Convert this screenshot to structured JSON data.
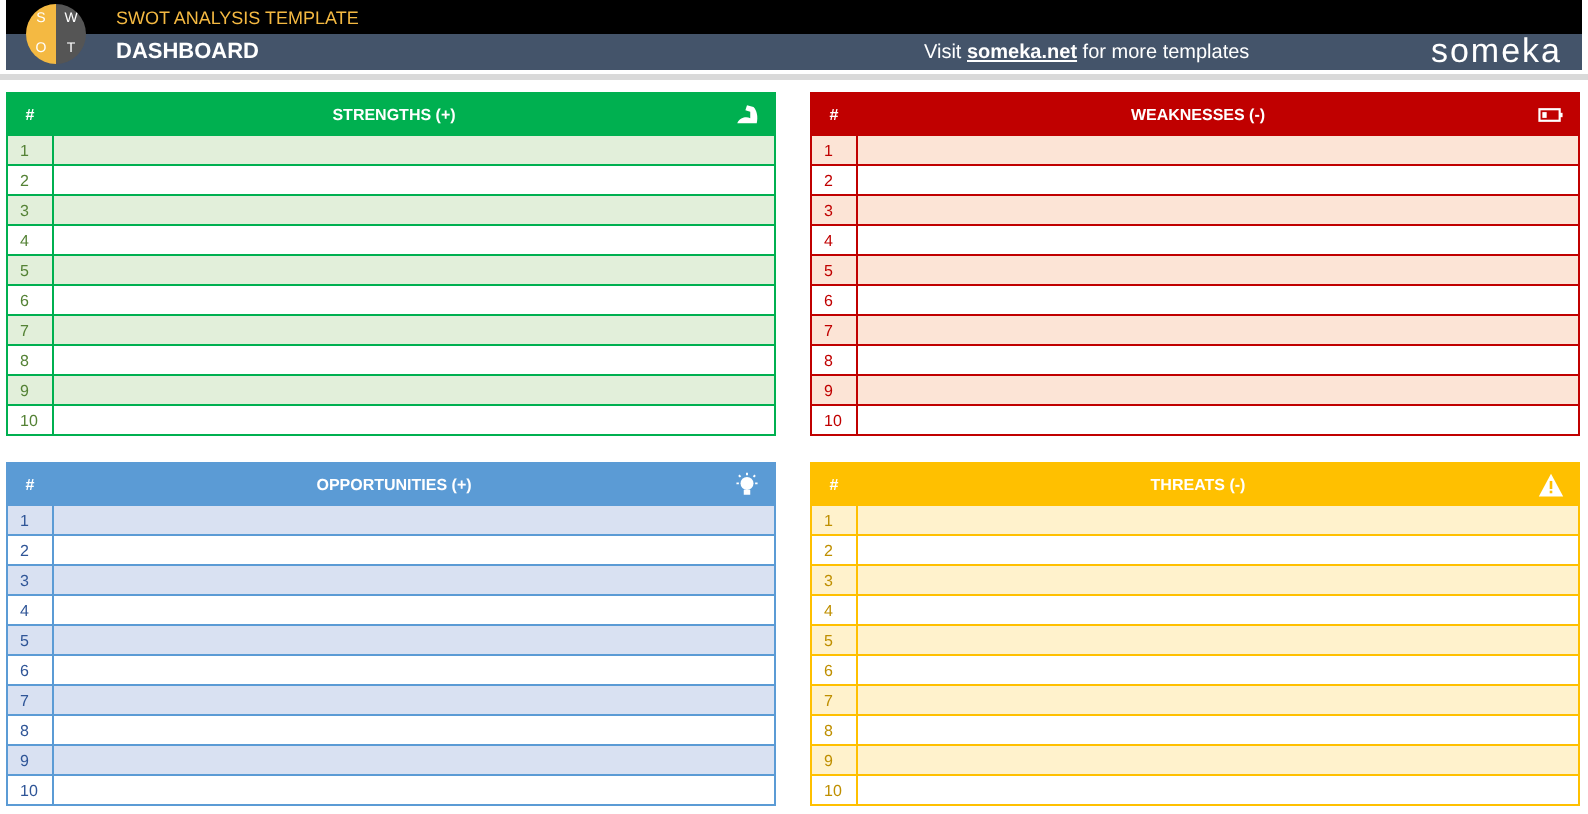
{
  "header": {
    "logo_letters": [
      "S",
      "W",
      "O",
      "T"
    ],
    "template_title": "SWOT ANALYSIS TEMPLATE",
    "page_title": "DASHBOARD",
    "promo_before": "Visit",
    "promo_link": "someka.net",
    "promo_after": "for more templates",
    "brand": "someka"
  },
  "quadrants": [
    {
      "kind": "strength",
      "title": "STRENGTHS (+)",
      "number_heading": "#",
      "color": "#00b050",
      "rows": [
        "1",
        "2",
        "3",
        "4",
        "5",
        "6",
        "7",
        "8",
        "9",
        "10"
      ]
    },
    {
      "kind": "weakness",
      "title": "WEAKNESSES (-)",
      "number_heading": "#",
      "color": "#c00000",
      "rows": [
        "1",
        "2",
        "3",
        "4",
        "5",
        "6",
        "7",
        "8",
        "9",
        "10"
      ]
    },
    {
      "kind": "opportunity",
      "title": "OPPORTUNITIES (+)",
      "number_heading": "#",
      "color": "#5b9bd5",
      "rows": [
        "1",
        "2",
        "3",
        "4",
        "5",
        "6",
        "7",
        "8",
        "9",
        "10"
      ]
    },
    {
      "kind": "threat",
      "title": "THREATS (-)",
      "number_heading": "#",
      "color": "#ffc000",
      "rows": [
        "1",
        "2",
        "3",
        "4",
        "5",
        "6",
        "7",
        "8",
        "9",
        "10"
      ]
    }
  ]
}
